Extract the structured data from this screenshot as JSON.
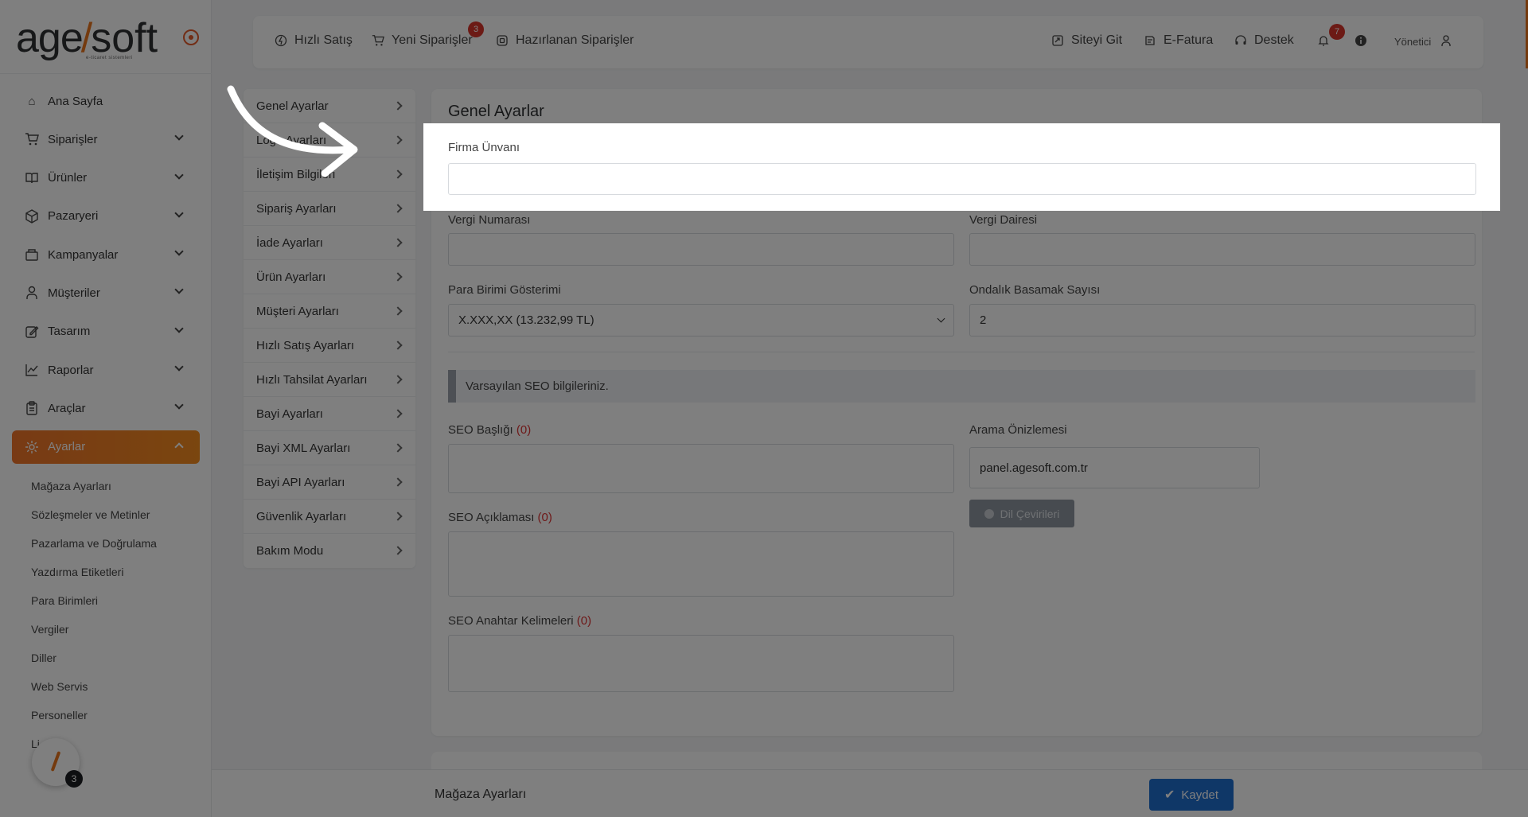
{
  "logo": {
    "part1": "age",
    "slash": "/",
    "part2": "soft",
    "tagline": "e-ticaret sistemleri"
  },
  "sidebar": {
    "items": [
      {
        "label": "Ana Sayfa",
        "icon": "home-icon",
        "expandable": false
      },
      {
        "label": "Siparişler",
        "icon": "cart-icon",
        "expandable": true
      },
      {
        "label": "Ürünler",
        "icon": "book-icon",
        "expandable": true
      },
      {
        "label": "Pazaryeri",
        "icon": "box-icon",
        "expandable": true
      },
      {
        "label": "Kampanyalar",
        "icon": "basket-icon",
        "expandable": true
      },
      {
        "label": "Müşteriler",
        "icon": "user-icon",
        "expandable": true
      },
      {
        "label": "Tasarım",
        "icon": "edit-icon",
        "expandable": true
      },
      {
        "label": "Raporlar",
        "icon": "chart-icon",
        "expandable": true
      },
      {
        "label": "Araçlar",
        "icon": "clipboard-icon",
        "expandable": true
      },
      {
        "label": "Ayarlar",
        "icon": "gear-icon",
        "expandable": true,
        "active": true
      }
    ],
    "subitems": [
      "Mağaza Ayarları",
      "Sözleşmeler ve Metinler",
      "Pazarlama ve Doğrulama",
      "Yazdırma Etiketleri",
      "Para Birimleri",
      "Vergiler",
      "Diller",
      "Web Servis",
      "Personeller",
      "Li"
    ],
    "fab_badge": "3"
  },
  "topbar": {
    "hizli_satis": "Hızlı Satış",
    "yeni_siparisler": "Yeni Siparişler",
    "yeni_siparisler_badge": "3",
    "hazirlanan": "Hazırlanan Siparişler",
    "siteyi_git": "Siteyi Git",
    "efatura": "E-Fatura",
    "destek": "Destek",
    "notif_badge": "7",
    "user": "Yönetici"
  },
  "settings_menu": [
    "Genel Ayarlar",
    "Logo Ayarları",
    "İletişim Bilgileri",
    "Sipariş Ayarları",
    "İade Ayarları",
    "Ürün Ayarları",
    "Müşteri Ayarları",
    "Hızlı Satış Ayarları",
    "Hızlı Tahsilat Ayarları",
    "Bayi Ayarları",
    "Bayi XML Ayarları",
    "Bayi API Ayarları",
    "Güvenlik Ayarları",
    "Bakım Modu"
  ],
  "form": {
    "title": "Genel Ayarlar",
    "firma_unvani_label": "Firma Ünvanı",
    "firma_unvani_value": "",
    "vergi_no_label": "Vergi Numarası",
    "vergi_dairesi_label": "Vergi Dairesi",
    "para_birimi_label": "Para Birimi Gösterimi",
    "para_birimi_value": "X.XXX,XX (13.232,99 TL)",
    "ondalik_label": "Ondalık Basamak Sayısı",
    "ondalik_value": "2",
    "seo_info": "Varsayılan SEO bilgileriniz.",
    "seo_baslik_label": "SEO Başlığı",
    "seo_baslik_count": "(0)",
    "seo_aciklama_label": "SEO Açıklaması",
    "seo_aciklama_count": "(0)",
    "seo_anahtar_label": "SEO Anahtar Kelimeleri",
    "seo_anahtar_count": "(0)",
    "arama_onizleme_label": "Arama Önizlemesi",
    "arama_onizleme_value": "panel.agesoft.com.tr",
    "dil_cevirileri": "Dil Çevirileri"
  },
  "bottombar": {
    "title": "Mağaza Ayarları",
    "save": "Kaydet"
  },
  "colors": {
    "accent": "#f0752a",
    "primary": "#1f6fcf",
    "badge": "#d9342b"
  }
}
